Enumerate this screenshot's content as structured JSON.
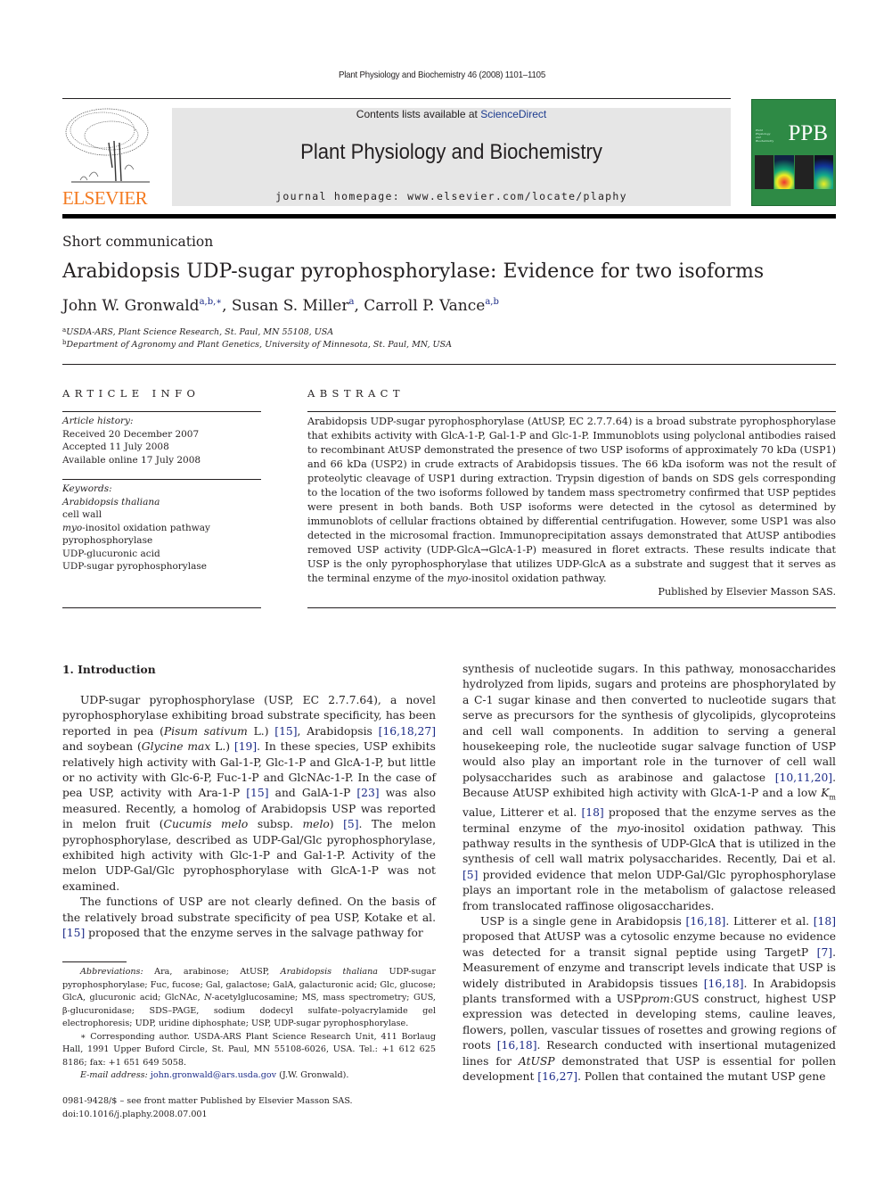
{
  "header": {
    "citation": "Plant Physiology and Biochemistry 46 (2008) 1101–1105",
    "contents_prefix": "Contents lists available at ",
    "contents_link": "ScienceDirect",
    "journal_title": "Plant Physiology and Biochemistry",
    "homepage": "journal homepage: www.elsevier.com/locate/plaphy",
    "publisher_logo_text": "ELSEVIER",
    "cover_abbrev": "PPB",
    "cover_small_title": "Plant Physiology and Biochemistry"
  },
  "colors": {
    "elsevier_orange": "#f47a20",
    "link_blue": "#1c2b87",
    "cover_green": "#2e8a45",
    "masthead_gray": "#e6e6e6"
  },
  "article": {
    "type": "Short communication",
    "title": "Arabidopsis UDP-sugar pyrophosphorylase: Evidence for two isoforms",
    "authors": [
      {
        "name": "John W. Gronwald",
        "sup": "a,b,∗"
      },
      {
        "name": "Susan S. Miller",
        "sup": "a"
      },
      {
        "name": "Carroll P. Vance",
        "sup": "a,b"
      }
    ],
    "affiliations": [
      {
        "label": "a",
        "text": "USDA-ARS, Plant Science Research, St. Paul, MN 55108, USA"
      },
      {
        "label": "b",
        "text": "Department of Agronomy and Plant Genetics, University of Minnesota, St. Paul, MN, USA"
      }
    ]
  },
  "article_info": {
    "heading": "ARTICLE INFO",
    "history_label": "Article history:",
    "received": "Received 20 December 2007",
    "accepted": "Accepted 11 July 2008",
    "online": "Available online 17 July 2008",
    "keywords_label": "Keywords:",
    "keywords": [
      "Arabidopsis thaliana",
      "cell wall",
      "myo-inositol oxidation pathway",
      "pyrophosphorylase",
      "UDP-glucuronic acid",
      "UDP-sugar pyrophosphorylase"
    ]
  },
  "abstract": {
    "heading": "ABSTRACT",
    "text_1": "Arabidopsis UDP-sugar pyrophosphorylase (AtUSP, EC 2.7.7.64) is a broad substrate pyrophosphorylase that exhibits activity with GlcA-1-P, Gal-1-P and Glc-1-P. Immunoblots using polyclonal antibodies raised to recombinant AtUSP demonstrated the presence of two USP isoforms of approximately 70 kDa (USP1) and 66 kDa (USP2) in crude extracts of Arabidopsis tissues. The 66 kDa isoform was not the result of proteolytic cleavage of USP1 during extraction. Trypsin digestion of bands on SDS gels corresponding to the location of the two isoforms followed by tandem mass spectrometry confirmed that USP peptides were present in both bands. Both USP isoforms were detected in the cytosol as determined by immunoblots of cellular fractions obtained by differential centrifugation. However, some USP1 was also detected in the microsomal fraction. Immunoprecipitation assays demonstrated that AtUSP antibodies removed USP activity (UDP-GlcA→GlcA-1-P) measured in floret extracts. These results indicate that USP is the only pyrophosphorylase that utilizes UDP-GlcA as a substrate and suggest that it serves as the terminal enzyme of the ",
    "text_italic": "myo",
    "text_2": "-inositol oxidation pathway.",
    "published_by": "Published by Elsevier Masson SAS."
  },
  "introduction": {
    "heading": "1.  Introduction",
    "left_col": [
      [
        "UDP-sugar pyrophosphorylase (USP, EC 2.7.7.64), a novel pyrophosphorylase exhibiting broad substrate specificity, has been reported in pea (",
        {
          "i": "Pisum sativum"
        },
        " L.) ",
        {
          "r": "[15]"
        },
        ", Arabidopsis ",
        {
          "r": "[16,18,27]"
        },
        " and soybean (",
        {
          "i": "Glycine max"
        },
        " L.) ",
        {
          "r": "[19]"
        },
        ". In these species, USP exhibits relatively high activity with Gal-1-P, Glc-1-P and GlcA-1-P, but little or no activity with Glc-6-P, Fuc-1-P and GlcNAc-1-P. In the case of pea USP, activity with Ara-1-P ",
        {
          "r": "[15]"
        },
        " and GalA-1-P ",
        {
          "r": "[23]"
        },
        " was also measured. Recently, a homolog of Arabidopsis USP was reported in melon fruit (",
        {
          "i": "Cucumis melo"
        },
        " subsp. ",
        {
          "i": "melo"
        },
        ") ",
        {
          "r": "[5]"
        },
        ". The melon pyrophosphorylase, described as UDP-Gal/Glc pyrophosphorylase, exhibited high activity with Glc-1-P and Gal-1-P. Activity of the melon UDP-Gal/Glc pyrophosphorylase with GlcA-1-P was not examined."
      ],
      [
        "The functions of USP are not clearly defined. On the basis of the relatively broad substrate specificity of pea USP, Kotake et al. ",
        {
          "r": "[15]"
        },
        " proposed that the enzyme serves in the salvage pathway for"
      ]
    ],
    "right_col": [
      [
        "synthesis of nucleotide sugars. In this pathway, monosaccharides hydrolyzed from lipids, sugars and proteins are phosphorylated by a C-1 sugar kinase and then converted to nucleotide sugars that serve as precursors for the synthesis of glycolipids, glycoproteins and cell wall components. In addition to serving a general housekeeping role, the nucleotide sugar salvage function of USP would also play an important role in the turnover of cell wall polysaccharides such as arabinose and galactose ",
        {
          "r": "[10,11,20]"
        },
        ". Because AtUSP exhibited high activity with GlcA-1-P and a low ",
        {
          "i": "K"
        },
        {
          "sub": "m"
        },
        " value, Litterer et al. ",
        {
          "r": "[18]"
        },
        " proposed that the enzyme serves as the terminal enzyme of the ",
        {
          "i": "myo"
        },
        "-inositol oxidation pathway. This pathway results in the synthesis of UDP-GlcA that is utilized in the synthesis of cell wall matrix polysaccharides. Recently, Dai et al. ",
        {
          "r": "[5]"
        },
        " provided evidence that melon UDP-Gal/Glc pyrophosphorylase plays an important role in the metabolism of galactose released from translocated raffinose oligosaccharides."
      ],
      [
        "USP is a single gene in Arabidopsis ",
        {
          "r": "[16,18]"
        },
        ". Litterer et al. ",
        {
          "r": "[18]"
        },
        " proposed that AtUSP was a cytosolic enzyme because no evidence was detected for a transit signal peptide using TargetP ",
        {
          "r": "[7]"
        },
        ". Measurement of enzyme and transcript levels indicate that USP is widely distributed in Arabidopsis tissues ",
        {
          "r": "[16,18]"
        },
        ". In Arabidopsis plants transformed with a USP",
        {
          "i": "prom"
        },
        ":GUS construct, highest USP expression was detected in developing stems, cauline leaves, flowers, pollen, vascular tissues of rosettes and growing regions of roots ",
        {
          "r": "[16,18]"
        },
        ". Research conducted with insertional mutagenized lines for ",
        {
          "i": "AtUSP"
        },
        " demonstrated that USP is essential for pollen development ",
        {
          "r": "[16,27]"
        },
        ". Pollen that contained the mutant USP gene"
      ]
    ]
  },
  "footnotes": {
    "abbreviations": [
      {
        "i": "Abbreviations:"
      },
      " Ara, arabinose; AtUSP, ",
      {
        "i": "Arabidopsis thaliana"
      },
      " UDP-sugar pyrophosphorylase; Fuc, fucose; Gal, galactose; GalA, galacturonic acid; Glc, glucose; GlcA, glucuronic acid; GlcNAc, ",
      {
        "i": "N"
      },
      "-acetylglucosamine; MS, mass spectrometry; GUS, β-glucuronidase; SDS–PAGE, sodium dodecyl sulfate–polyacrylamide gel electrophoresis; UDP, uridine diphosphate; USP, UDP-sugar pyrophosphorylase."
    ],
    "corresponding": [
      "∗ Corresponding author. USDA-ARS Plant Science Research Unit, 411 Borlaug Hall, 1991 Upper Buford Circle, St. Paul, MN 55108-6026, USA. Tel.: +1 612 625 8186; fax: +1 651 649 5058."
    ],
    "email": [
      {
        "i": "E-mail address:"
      },
      " ",
      {
        "r": "john.gronwald@ars.usda.gov"
      },
      " (J.W. Gronwald)."
    ],
    "issn": "0981-9428/$ – see front matter Published by Elsevier Masson SAS.",
    "doi": "doi:10.1016/j.plaphy.2008.07.001"
  }
}
